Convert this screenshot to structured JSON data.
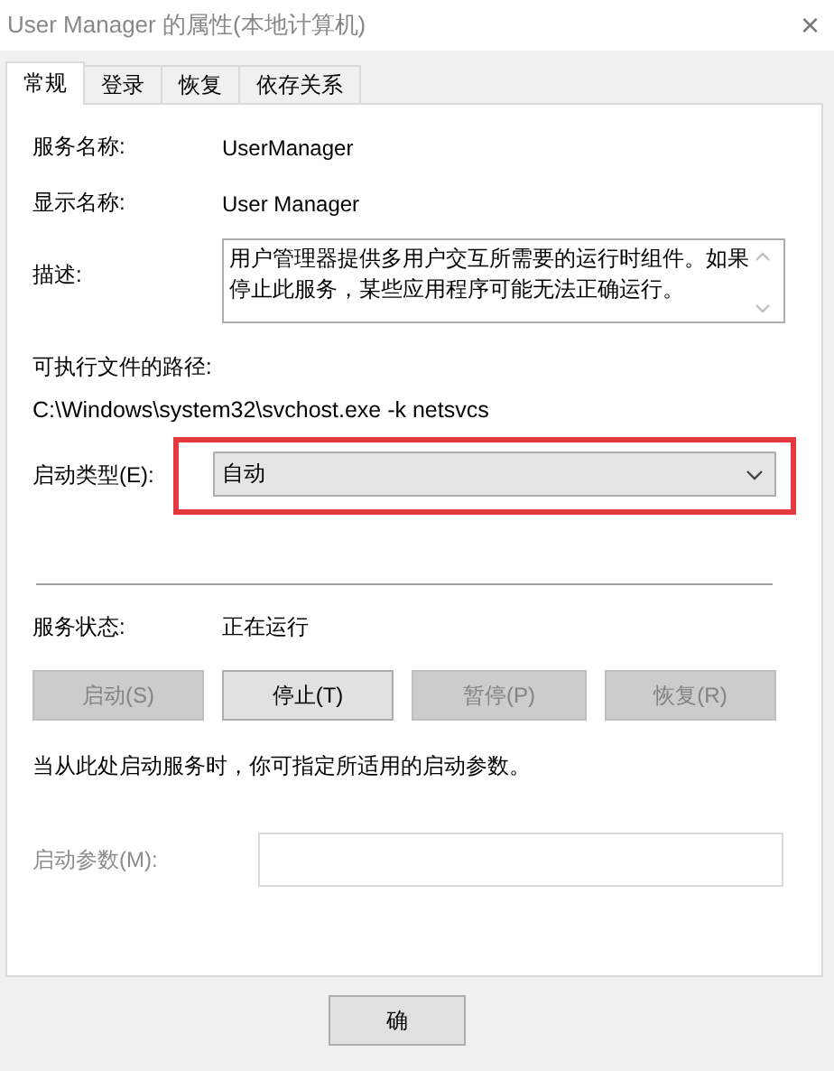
{
  "window": {
    "title": "User Manager 的属性(本地计算机)",
    "close": "×"
  },
  "tabs": [
    {
      "label": "常规",
      "selected": true
    },
    {
      "label": "登录",
      "selected": false
    },
    {
      "label": "恢复",
      "selected": false
    },
    {
      "label": "依存关系",
      "selected": false
    }
  ],
  "service_name": {
    "label": "服务名称:",
    "value": "UserManager"
  },
  "display_name": {
    "label": "显示名称:",
    "value": "User Manager"
  },
  "description": {
    "label": "描述:",
    "value": "用户管理器提供多用户交互所需要的运行时组件。如果停止此服务，某些应用程序可能无法正确运行。"
  },
  "executable_path": {
    "label": "可执行文件的路径:",
    "value": "C:\\Windows\\system32\\svchost.exe -k netsvcs"
  },
  "startup_type": {
    "label": "启动类型(E):",
    "value": "自动",
    "highlighted": true
  },
  "service_status": {
    "label": "服务状态:",
    "value": "正在运行"
  },
  "control_buttons": [
    {
      "label": "启动(S)",
      "disabled": true
    },
    {
      "label": "停止(T)",
      "disabled": false
    },
    {
      "label": "暂停(P)",
      "disabled": true
    },
    {
      "label": "恢复(R)",
      "disabled": true
    }
  ],
  "hint": "当从此处启动服务时，你可指定所适用的启动参数。",
  "start_parameters": {
    "label": "启动参数(M):",
    "disabled": true
  },
  "dialog_buttons": [
    {
      "label": "确"
    }
  ]
}
